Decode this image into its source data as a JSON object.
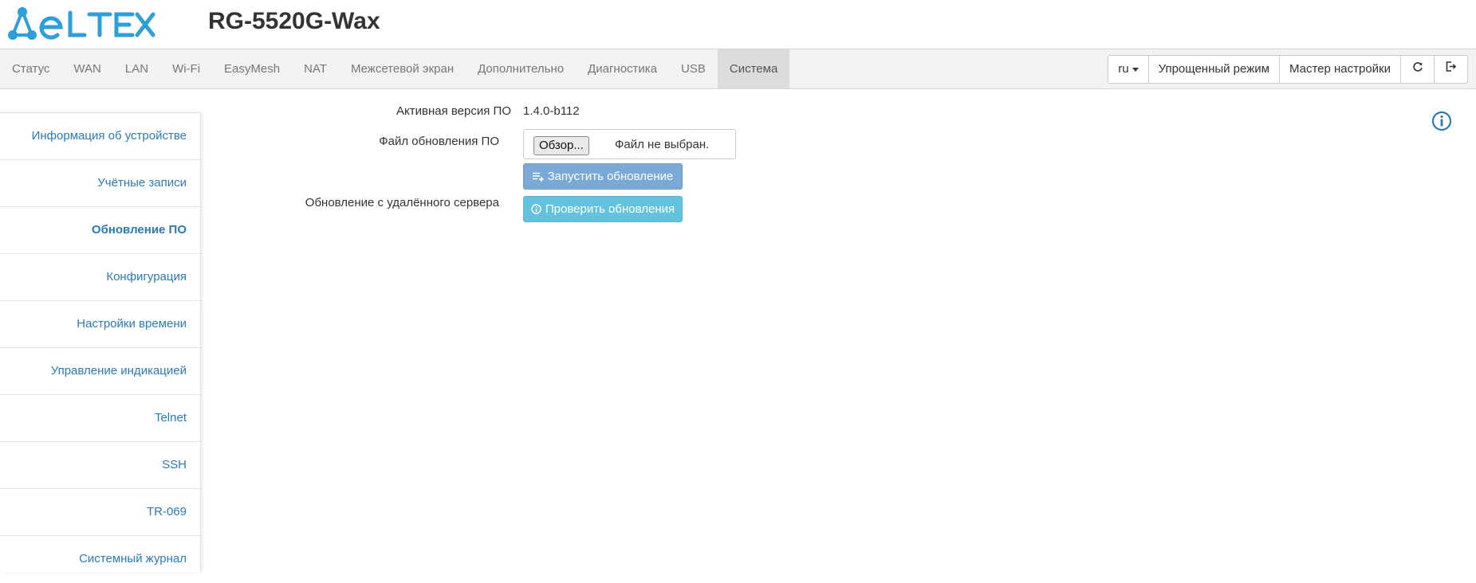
{
  "header": {
    "logo_text": "ELTEX",
    "device_title": "RG-5520G-Wax"
  },
  "nav": {
    "tabs": [
      {
        "label": "Статус"
      },
      {
        "label": "WAN"
      },
      {
        "label": "LAN"
      },
      {
        "label": "Wi-Fi"
      },
      {
        "label": "EasyMesh"
      },
      {
        "label": "NAT"
      },
      {
        "label": "Межсетевой экран"
      },
      {
        "label": "Дополнительно"
      },
      {
        "label": "Диагностика"
      },
      {
        "label": "USB"
      },
      {
        "label": "Система",
        "active": true
      }
    ],
    "language": "ru",
    "simple_mode_label": "Упрощенный режим",
    "wizard_label": "Мастер настройки",
    "refresh_icon": "refresh-icon",
    "logout_icon": "logout-icon"
  },
  "sidebar": {
    "items": [
      {
        "label": "Информация об устройстве"
      },
      {
        "label": "Учётные записи"
      },
      {
        "label": "Обновление ПО",
        "active": true
      },
      {
        "label": "Конфигурация"
      },
      {
        "label": "Настройки времени"
      },
      {
        "label": "Управление индикацией"
      },
      {
        "label": "Telnet"
      },
      {
        "label": "SSH"
      },
      {
        "label": "TR-069"
      },
      {
        "label": "Системный журнал"
      }
    ]
  },
  "main": {
    "active_version_label": "Активная версия ПО",
    "active_version_value": "1.4.0-b112",
    "update_file_label": "Файл обновления ПО",
    "browse_label": "Обзор...",
    "no_file_label": "Файл не выбран.",
    "start_update_label": "Запустить обновление",
    "remote_update_label": "Обновление с удалённого сервера",
    "check_updates_label": "Проверить обновления",
    "info_icon": "info-icon"
  },
  "colors": {
    "brand": "#2e9fd8",
    "link": "#2a7ab8",
    "primary_button": "#7ba9d6",
    "info_button": "#5bc0de"
  }
}
